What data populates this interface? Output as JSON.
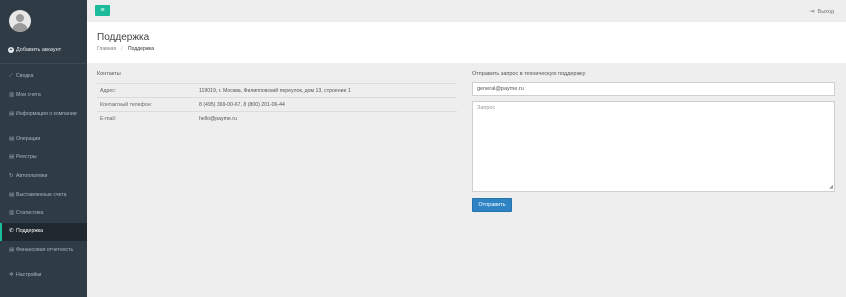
{
  "sidebar": {
    "add_account": "Добавить аккаунт",
    "items": [
      {
        "icon": "line-chart-icon",
        "glyph": "⟋",
        "label": "Сводка"
      },
      {
        "icon": "bar-chart-icon",
        "glyph": "▥",
        "label": "Мои счета"
      },
      {
        "icon": "document-icon",
        "glyph": "▤",
        "label": "Информация о компании"
      },
      {
        "icon": "copy-icon",
        "glyph": "▤",
        "label": "Операции"
      },
      {
        "icon": "copy-icon",
        "glyph": "▤",
        "label": "Реестры"
      },
      {
        "icon": "refresh-icon",
        "glyph": "↻",
        "label": "Автоплатежи"
      },
      {
        "icon": "document-icon",
        "glyph": "▤",
        "label": "Выставленные счета"
      },
      {
        "icon": "bar-chart-icon",
        "glyph": "▥",
        "label": "Статистика"
      },
      {
        "icon": "phone-icon",
        "glyph": "✆",
        "label": "Поддержка"
      },
      {
        "icon": "document-icon",
        "glyph": "▤",
        "label": "Финансовая отчетность"
      },
      {
        "icon": "gear-icon",
        "glyph": "✲",
        "label": "Настройки"
      }
    ],
    "active_index": 8
  },
  "topbar": {
    "menu_glyph": "≡",
    "logout_glyph": "⇥",
    "logout_label": "Выход"
  },
  "page": {
    "title": "Поддержка",
    "breadcrumb_home": "Главная",
    "breadcrumb_sep": "/",
    "breadcrumb_current": "Поддержка"
  },
  "contacts": {
    "title": "Контакты",
    "rows": [
      {
        "label": "Адрес:",
        "value": "119019, г. Москва, Филипповский переулок, дом 13, строение 1"
      },
      {
        "label": "Контактный телефон:",
        "value": "8 (495) 369-00-67, 8 (800) 201-06-44"
      },
      {
        "label": "E-mail:",
        "value": "hello@payme.ru"
      }
    ]
  },
  "support_form": {
    "title": "Отправить запрос в техническую поддержку",
    "email_value": "general@payme.ru",
    "request_placeholder": "Запрос",
    "submit_label": "Отправить"
  },
  "colors": {
    "sidebar_bg": "#2f3b45",
    "accent_green": "#1abc9c",
    "primary_blue": "#2d83c4"
  }
}
